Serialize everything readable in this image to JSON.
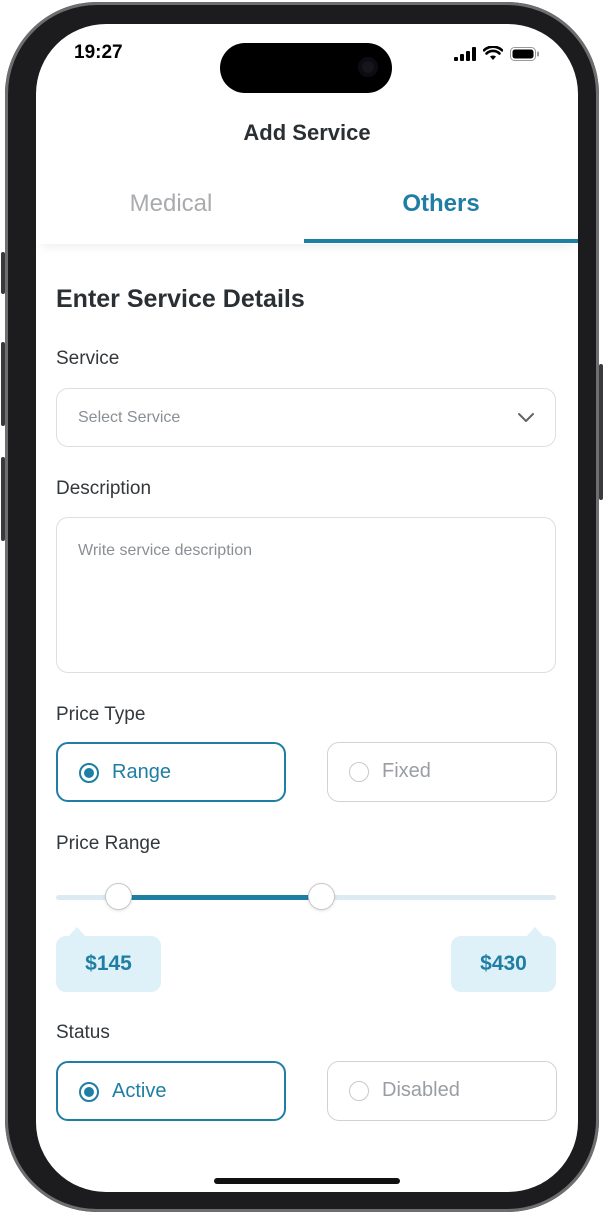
{
  "status_bar": {
    "time": "19:27",
    "icons": [
      "signal-icon",
      "wifi-icon",
      "battery-icon"
    ]
  },
  "header": {
    "title": "Add Service"
  },
  "tabs": [
    {
      "label": "Medical",
      "active": false
    },
    {
      "label": "Others",
      "active": true
    }
  ],
  "form": {
    "heading": "Enter Service Details",
    "service": {
      "label": "Service",
      "placeholder": "Select Service",
      "icon": "chevron-down-icon"
    },
    "description": {
      "label": "Description",
      "placeholder": "Write service description"
    },
    "price_type": {
      "label": "Price Type",
      "options": [
        {
          "label": "Range",
          "selected": true
        },
        {
          "label": "Fixed",
          "selected": false
        }
      ]
    },
    "price_range": {
      "label": "Price Range",
      "min_display": "$145",
      "max_display": "$430",
      "min_fraction": 0.125,
      "max_fraction": 0.53
    },
    "status": {
      "label": "Status",
      "options": [
        {
          "label": "Active",
          "selected": true
        },
        {
          "label": "Disabled",
          "selected": false
        }
      ]
    }
  },
  "colors": {
    "accent": "#1f7ea3",
    "bubble": "#def0f8",
    "track": "#dcebf1"
  }
}
